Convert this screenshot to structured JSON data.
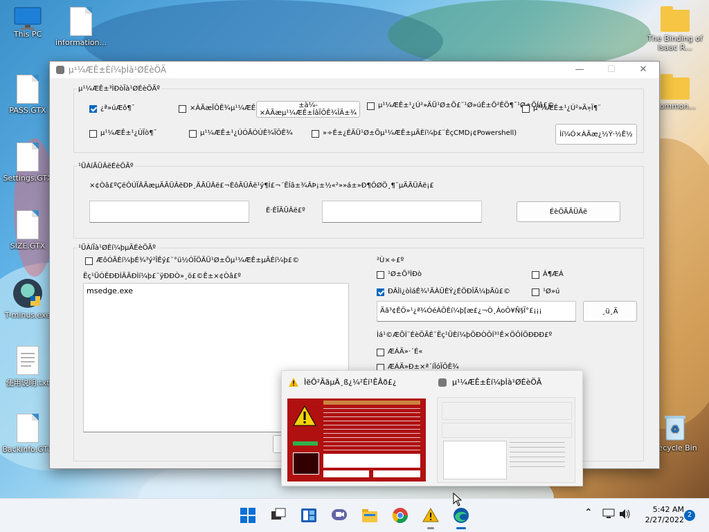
{
  "desktop": {
    "icons_left": [
      {
        "label": "This PC",
        "icon": "monitor-icon"
      },
      {
        "label": "PASS.GTX",
        "icon": "file-icon"
      },
      {
        "label": "Settings.GTX",
        "icon": "file-icon"
      },
      {
        "label": "SIZE.GTX",
        "icon": "file-icon"
      },
      {
        "label": "T-minus.exe",
        "icon": "app-icon"
      },
      {
        "label": "使用说明.txt",
        "icon": "text-file-icon"
      },
      {
        "label": "BackInfo.GTX",
        "icon": "file-icon"
      }
    ],
    "icon_top_second": {
      "label": "information...",
      "icon": "file-icon"
    },
    "icons_right": [
      {
        "label": "The Binding of Isaac R...",
        "icon": "folder-icon"
      },
      {
        "label": "Common...",
        "icon": "folder-icon"
      },
      {
        "label": "Recycle Bin",
        "icon": "recycle-bin-icon"
      }
    ]
  },
  "window": {
    "title": "µ¹¼ÆÊ±Èí¼þÌà¹ØÉèÖÃ",
    "close_glyph": "✕",
    "min_glyph": "—",
    "max_glyph": "☐"
  },
  "group1": {
    "title": "µ¹¼ÆÊ±³ÌÐòÏà¹ØÉèÖÃº",
    "items": [
      {
        "label": "¿ª»úÆô¶¯",
        "checked": true
      },
      {
        "label": "×ÀÃæÏÔÊ¾µ¹¼ÆÊ±",
        "checked": false
      },
      {
        "label": "µ¹¼ÆÊ±¹¿Ú²»ÄÜ¹Ø±Õ£¨¹Ø»úÊ±Ö²ÊÖ¶¯¹Ø±ÕÍâ£©",
        "checked": false
      },
      {
        "label": "µ¹¼ÆÊ±¹¿Ú²»Äܱ»Ï¶¨",
        "checked": false
      },
      {
        "label": "µ¹¼ÆÊ±¹¿ÚÏò¶¯",
        "checked": false
      },
      {
        "label": "µ¹¼ÆÊ±¹¿ÚÓÃÓÚÊ¾ÏÔÊ¾",
        "checked": false
      },
      {
        "label": "»÷É±¿ÉÄÜ¹Ø±Õµ¹¼ÆÊ±µÄÈí¼þ£¨ÈçCMD¡¢Powershell)",
        "checked": false
      }
    ],
    "button1": "±à¼­×ÀÃæµ¹¼ÆÊ±ÍâÏÔÊ¾ÎÄ±¾",
    "button2": "Ìí¼Ó×ÀÃæ¿½Ý·½Ê½"
  },
  "group2": {
    "title": "¹ÜÀíÃÜÂëÉèÖÃº",
    "description": "×¢Òâ£ºÇëÔÚÏÂÃæµÄÃÜÂëÐÞ¸ÄÃÜÂë£¬ÈôÃÜÂë¹ý¶Ì£¬´ËÍâ±¾ÂÞ¡±½«²»»á±»Ð¶ÔØÖ¸¶¨µÄÃÜÂë¡£",
    "password_value": "",
    "confirm_label": "È·ÈÏÃÜÂë£º",
    "confirm_value": "",
    "button": "ÉèÖÃÃÜÂë"
  },
  "group3": {
    "title": "¹ÜÀíÏà¹ØÈí¼þµÄÉèÖÃº",
    "checkbox_label": "ÆôÓÃÈí¼þÉ¾³ý²ÎÊý£¨°ü½ÓÏÖÄÜ¹Ø±Õµ¹¼ÆÊ±µÄÈí¼þ£©",
    "list_label": "Ëç¹ÜÒÊÐÐÌÄÃÐÌí¼þ£¨ÿÐÐÒ»¸ö£©Ê±×¢Òâ£º",
    "list_value": "msedge.exe",
    "right_title": "²Ù×÷£º",
    "options": [
      {
        "label": "¹Ø±Õ³ÌÐò",
        "checked": false
      },
      {
        "label": "À¶ÆÁ",
        "checked": false
      },
      {
        "label": "ÐÂÌì¿òÌáÊ¾¹ÃÀÜÈÝ¿ÉÖÐÎÄ¼þÃû£©",
        "checked": true
      },
      {
        "label": "¹Ø»ú",
        "checked": false
      }
    ],
    "message_value": "Äã³¢ÊÔ»¹¿ª¾ÓéÀÖÈí¼þ[æ£¿¬Ò¸ÀoÔ¥Ñ§Ï°£¡¡¡",
    "small_button": "¸ü¸Ä",
    "bottom_title": "Ìá¹©ÆÕÍ¨ÉèÖÃÉ¨Ëç¹ÜÈí¼þÖÐÒÔÍ³¹Ê×ÖÔÍÖÐÐÐ£º",
    "bottom_options": [
      {
        "label": "ÆÁÄ»·´É«",
        "checked": false
      },
      {
        "label": "ÆÁÄ»Ð±×ª´íÎóÏÔÊ¾",
        "checked": false
      }
    ]
  },
  "thumbnails": [
    {
      "title": "ÌëÔ²ÃãµÄ¸ß¿¼²Éí¹ÊÂð£¿",
      "icon": "warning-icon"
    },
    {
      "title": "µ¹¼ÆÊ±Èí¼þÌà¹ØÉèÖÃ",
      "icon": "settings-app-icon"
    }
  ],
  "taskbar": {
    "time": "5:42 AM",
    "date": "2/27/2022",
    "notification_count": "2",
    "apps": [
      "start-icon",
      "task-view-icon",
      "widgets-icon",
      "chat-icon",
      "file-explorer-icon",
      "chrome-icon",
      "warning-app-icon",
      "edge-icon"
    ]
  },
  "colors": {
    "accent": "#0067c0",
    "taskbar": "#f0f3f8",
    "warning_red": "#b01010"
  }
}
